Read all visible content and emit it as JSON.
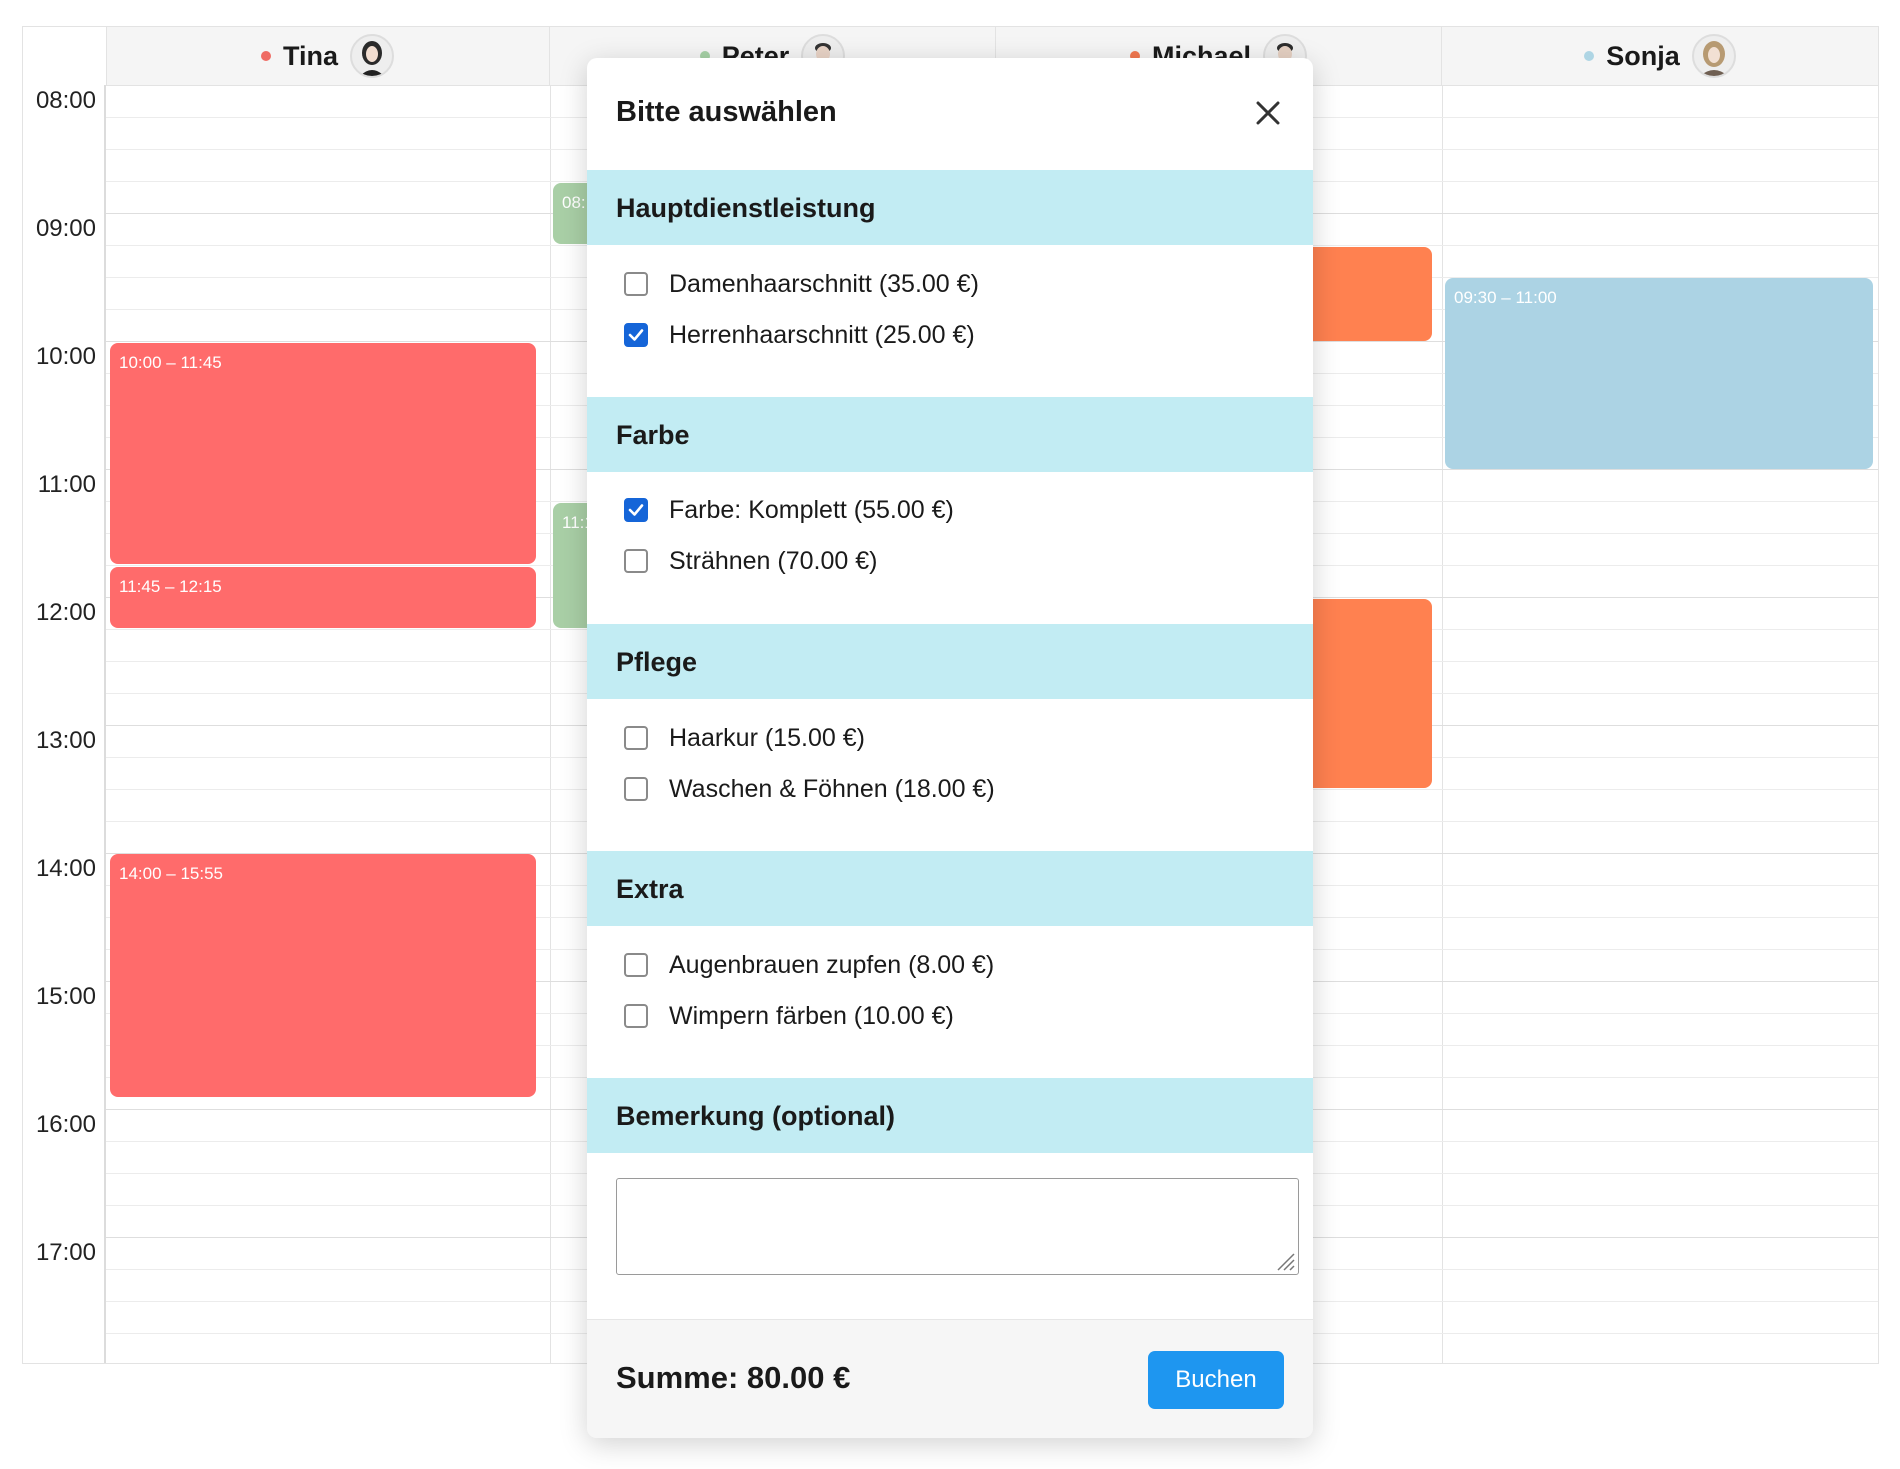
{
  "staff": [
    {
      "name": "Tina",
      "color": "#ef6b63"
    },
    {
      "name": "Peter",
      "color": "#a6d1a6"
    },
    {
      "name": "Michael",
      "color": "#f27850"
    },
    {
      "name": "Sonja",
      "color": "#aed5e4"
    }
  ],
  "times": [
    "08:00",
    "09:00",
    "10:00",
    "11:00",
    "12:00",
    "13:00",
    "14:00",
    "15:00",
    "16:00",
    "17:00"
  ],
  "events": {
    "tina_1": "10:00 – 11:45",
    "tina_2": "11:45 – 12:15",
    "tina_3": "14:00 – 15:55",
    "peter_1": "08:",
    "peter_2": "11:1",
    "sonja_1": "09:30 – 11:00"
  },
  "colors": {
    "tina_event": "#ff6b6b",
    "peter_event": "#a9cfa6",
    "michael_event": "#ff8150",
    "sonja_event": "#acd3e4",
    "section_bg": "#c2ecf3",
    "checkbox_checked": "#1565d8",
    "book_button": "#1e96f0"
  },
  "modal": {
    "title": "Bitte auswählen",
    "sections": [
      {
        "title": "Hauptdienstleistung",
        "options": [
          {
            "label": "Damenhaarschnitt (35.00 €)",
            "checked": false
          },
          {
            "label": "Herrenhaarschnitt (25.00 €)",
            "checked": true
          }
        ]
      },
      {
        "title": "Farbe",
        "options": [
          {
            "label": "Farbe: Komplett (55.00 €)",
            "checked": true
          },
          {
            "label": "Strähnen (70.00 €)",
            "checked": false
          }
        ]
      },
      {
        "title": "Pflege",
        "options": [
          {
            "label": "Haarkur (15.00 €)",
            "checked": false
          },
          {
            "label": "Waschen & Föhnen (18.00 €)",
            "checked": false
          }
        ]
      },
      {
        "title": "Extra",
        "options": [
          {
            "label": "Augenbrauen zupfen (8.00 €)",
            "checked": false
          },
          {
            "label": "Wimpern färben (10.00 €)",
            "checked": false
          }
        ]
      }
    ],
    "remark_title": "Bemerkung (optional)",
    "remark_value": "",
    "sum": "Summe: 80.00 €",
    "book_label": "Buchen"
  }
}
